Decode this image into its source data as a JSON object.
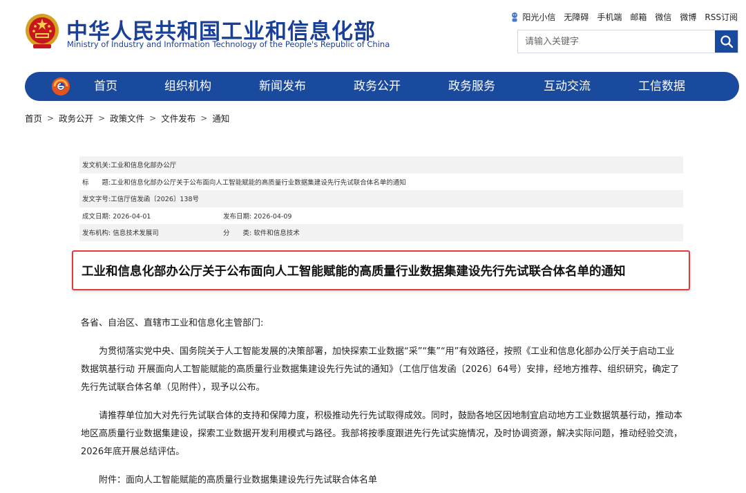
{
  "header": {
    "title": "中华人民共和国工业和信息化部",
    "subtitle": "Ministry of Industry and Information Technology of the People's Republic of China",
    "top_links": [
      "阳光小信",
      "无障碍",
      "手机端",
      "邮箱",
      "微信",
      "微博",
      "RSS订阅"
    ],
    "search_placeholder": "请输入关键字"
  },
  "nav": {
    "items": [
      "首页",
      "组织机构",
      "新闻发布",
      "政务公开",
      "政务服务",
      "互动交流",
      "工信数据"
    ]
  },
  "breadcrumb": [
    "首页",
    "政务公开",
    "政策文件",
    "文件发布",
    "通知"
  ],
  "meta": {
    "issuer_label": "发文机关:",
    "issuer": "工业和信息化部办公厅",
    "title_label": "标　　题:",
    "title": "工业和信息化部办公厅关于公布面向人工智能赋能的高质量行业数据集建设先行先试联合体名单的通知",
    "doc_no_label": "发文字号:",
    "doc_no": "工信厅信发函〔2026〕138号",
    "created_label": "成文日期:",
    "created": "2026-04-01",
    "published_label": "发布日期:",
    "published": "2026-04-09",
    "org_label": "发布机构:",
    "org": "信息技术发展司",
    "category_label": "分　　类:",
    "category": "软件和信息技术"
  },
  "article": {
    "title": "工业和信息化部办公厅关于公布面向人工智能赋能的高质量行业数据集建设先行先试联合体名单的通知",
    "salutation": "各省、自治区、直辖市工业和信息化主管部门:",
    "paragraphs": [
      "为贯彻落实党中央、国务院关于人工智能发展的决策部署，加快探索工业数据“采”“集”“用”有效路径，按照《工业和信息化部办公厅关于启动工业数据筑基行动 开展面向人工智能赋能的高质量行业数据集建设先行先试的通知》（工信厅信发函〔2026〕64号）安排，经地方推荐、组织研究，确定了先行先试联合体名单（见附件），现予以公布。",
      "请推荐单位加大对先行先试联合体的支持和保障力度，积极推动先行先试取得成效。同时，鼓励各地区因地制宜启动地方工业数据筑基行动，推动本地区高质量行业数据集建设，探索工业数据开发利用模式与路径。我部将按季度跟进先行先试实施情况，及时协调资源，解决实际问题，推动经验交流，2026年底开展总结评估。"
    ],
    "attachment": "附件：面向人工智能赋能的高质量行业数据集建设先行先试联合体名单"
  },
  "colors": {
    "brand_blue": "#1a4a9e",
    "highlight_red": "#e23a3a"
  },
  "icons": [
    "national-emblem-icon",
    "robot-icon",
    "search-icon",
    "nav-logo-icon",
    "chevron-right-icon"
  ]
}
